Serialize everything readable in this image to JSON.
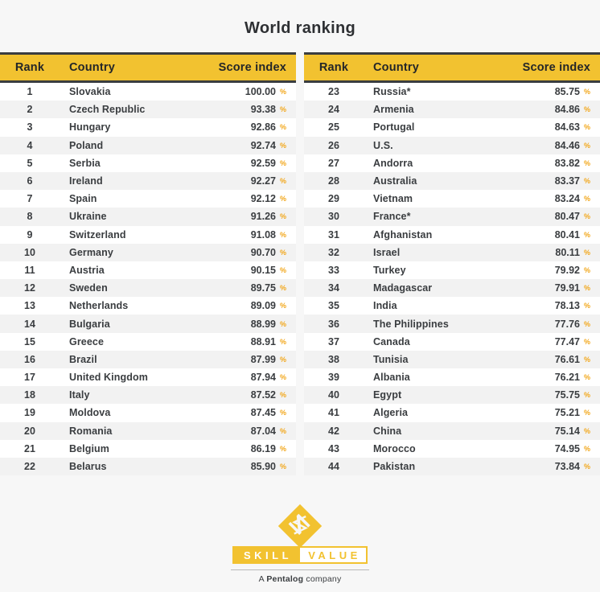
{
  "page": {
    "title": "World ranking",
    "background_color": "#f7f7f7",
    "accent_color": "#f2c230",
    "text_color": "#3a3d40",
    "percent_symbol": "%"
  },
  "columns": {
    "rank": "Rank",
    "country": "Country",
    "score": "Score index"
  },
  "tables": [
    {
      "id": "left",
      "rows": [
        {
          "rank": "1",
          "country": "Slovakia",
          "score": "100.00"
        },
        {
          "rank": "2",
          "country": "Czech Republic",
          "score": "93.38"
        },
        {
          "rank": "3",
          "country": "Hungary",
          "score": "92.86"
        },
        {
          "rank": "4",
          "country": "Poland",
          "score": "92.74"
        },
        {
          "rank": "5",
          "country": "Serbia",
          "score": "92.59"
        },
        {
          "rank": "6",
          "country": "Ireland",
          "score": "92.27"
        },
        {
          "rank": "7",
          "country": "Spain",
          "score": "92.12"
        },
        {
          "rank": "8",
          "country": "Ukraine",
          "score": "91.26"
        },
        {
          "rank": "9",
          "country": "Switzerland",
          "score": "91.08"
        },
        {
          "rank": "10",
          "country": "Germany",
          "score": "90.70"
        },
        {
          "rank": "11",
          "country": "Austria",
          "score": "90.15"
        },
        {
          "rank": "12",
          "country": "Sweden",
          "score": "89.75"
        },
        {
          "rank": "13",
          "country": "Netherlands",
          "score": "89.09"
        },
        {
          "rank": "14",
          "country": "Bulgaria",
          "score": "88.99"
        },
        {
          "rank": "15",
          "country": "Greece",
          "score": "88.91"
        },
        {
          "rank": "16",
          "country": "Brazil",
          "score": "87.99"
        },
        {
          "rank": "17",
          "country": "United Kingdom",
          "score": "87.94"
        },
        {
          "rank": "18",
          "country": "Italy",
          "score": "87.52"
        },
        {
          "rank": "19",
          "country": "Moldova",
          "score": "87.45"
        },
        {
          "rank": "20",
          "country": "Romania",
          "score": "87.04"
        },
        {
          "rank": "21",
          "country": "Belgium",
          "score": "86.19"
        },
        {
          "rank": "22",
          "country": "Belarus",
          "score": "85.90"
        }
      ]
    },
    {
      "id": "right",
      "rows": [
        {
          "rank": "23",
          "country": "Russia*",
          "score": "85.75"
        },
        {
          "rank": "24",
          "country": "Armenia",
          "score": "84.86"
        },
        {
          "rank": "25",
          "country": "Portugal",
          "score": "84.63"
        },
        {
          "rank": "26",
          "country": "U.S.",
          "score": "84.46"
        },
        {
          "rank": "27",
          "country": "Andorra",
          "score": "83.82"
        },
        {
          "rank": "28",
          "country": "Australia",
          "score": "83.37"
        },
        {
          "rank": "29",
          "country": "Vietnam",
          "score": "83.24"
        },
        {
          "rank": "30",
          "country": "France*",
          "score": "80.47"
        },
        {
          "rank": "31",
          "country": "Afghanistan",
          "score": "80.41"
        },
        {
          "rank": "32",
          "country": "Israel",
          "score": "80.11"
        },
        {
          "rank": "33",
          "country": "Turkey",
          "score": "79.92"
        },
        {
          "rank": "34",
          "country": "Madagascar",
          "score": "79.91"
        },
        {
          "rank": "35",
          "country": "India",
          "score": "78.13"
        },
        {
          "rank": "36",
          "country": "The Philippines",
          "score": "77.76"
        },
        {
          "rank": "37",
          "country": "Canada",
          "score": "77.47"
        },
        {
          "rank": "38",
          "country": "Tunisia",
          "score": "76.61"
        },
        {
          "rank": "39",
          "country": "Albania",
          "score": "76.21"
        },
        {
          "rank": "40",
          "country": "Egypt",
          "score": "75.75"
        },
        {
          "rank": "41",
          "country": "Algeria",
          "score": "75.21"
        },
        {
          "rank": "42",
          "country": "China",
          "score": "75.14"
        },
        {
          "rank": "43",
          "country": "Morocco",
          "score": "74.95"
        },
        {
          "rank": "44",
          "country": "Pakistan",
          "score": "73.84"
        }
      ]
    }
  ],
  "logo": {
    "mark_name": "skillvalue-diamond-logo",
    "word_first": "SKILL",
    "word_second": "VALUE",
    "tagline_prefix": "A ",
    "tagline_brand": "Pentalog",
    "tagline_suffix": " company"
  }
}
